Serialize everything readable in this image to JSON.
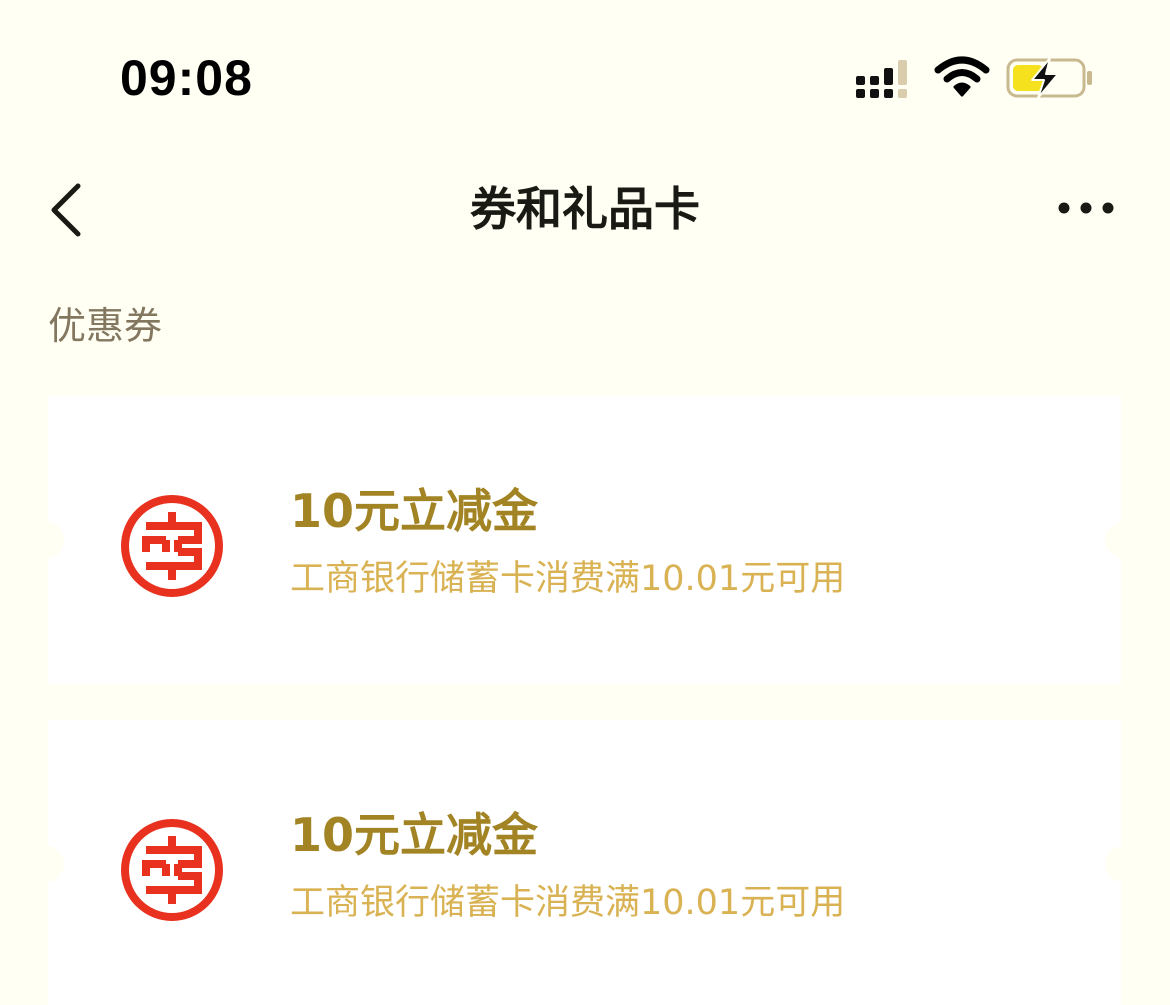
{
  "status_bar": {
    "time": "09:08"
  },
  "nav": {
    "title": "券和礼品卡"
  },
  "section": {
    "label": "优惠券"
  },
  "coupons": [
    {
      "title": "10元立减金",
      "description": "工商银行储蓄卡消费满10.01元可用",
      "logo_icon": "icbc-logo-icon"
    },
    {
      "title": "10元立减金",
      "description": "工商银行储蓄卡消费满10.01元可用",
      "logo_icon": "icbc-logo-icon"
    }
  ],
  "colors": {
    "background": "#fffff4",
    "card": "#ffffff",
    "title_gold": "#a38424",
    "desc_gold": "#d9b253",
    "section_label": "#847760",
    "icbc_red": "#e8311f",
    "battery_fill": "#f5e11e"
  }
}
